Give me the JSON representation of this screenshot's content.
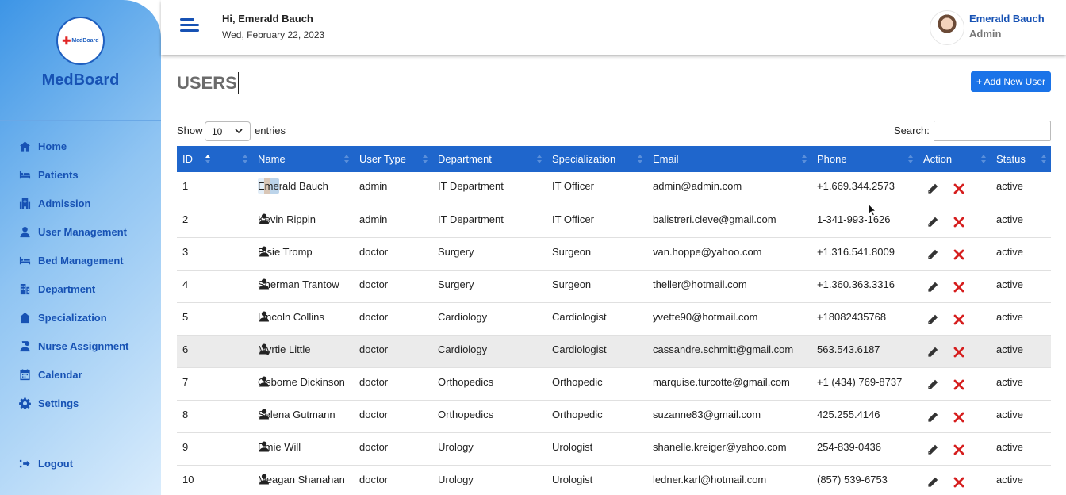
{
  "app": {
    "brand": "MedBoard",
    "logo_mini_text": "MedBoard"
  },
  "sidebar": {
    "items": [
      {
        "label": "Home",
        "icon": "home-icon"
      },
      {
        "label": "Patients",
        "icon": "bed-icon"
      },
      {
        "label": "Admission",
        "icon": "hospital-icon"
      },
      {
        "label": "User Management",
        "icon": "user-icon"
      },
      {
        "label": "Bed Management",
        "icon": "bed-icon"
      },
      {
        "label": "Department",
        "icon": "building-icon"
      },
      {
        "label": "Specialization",
        "icon": "house-medical-icon"
      },
      {
        "label": "Nurse Assignment",
        "icon": "nurse-icon"
      },
      {
        "label": "Calendar",
        "icon": "calendar-icon"
      },
      {
        "label": "Settings",
        "icon": "gear-icon"
      }
    ],
    "logout": {
      "label": "Logout",
      "icon": "logout-icon"
    }
  },
  "header": {
    "greeting": "Hi, Emerald Bauch",
    "date": "Wed, February 22, 2023",
    "user_name": "Emerald Bauch",
    "user_role": "Admin"
  },
  "page": {
    "title": "USERS",
    "add_button": "+ Add New User",
    "show_label": "Show",
    "entries_value": "10",
    "entries_label": "entries",
    "search_label": "Search:",
    "search_value": ""
  },
  "table": {
    "columns": [
      "ID",
      "",
      "Name",
      "User Type",
      "Department",
      "Specialization",
      "Email",
      "Phone",
      "Action",
      "Status"
    ],
    "rows": [
      {
        "id": "1",
        "name": "Emerald Bauch",
        "user_type": "admin",
        "department": "IT Department",
        "specialization": "IT Officer",
        "email": "admin@admin.com",
        "phone": "+1.669.344.2573",
        "status": "active"
      },
      {
        "id": "2",
        "name": "Kevin Rippin",
        "user_type": "admin",
        "department": "IT Department",
        "specialization": "IT Officer",
        "email": "balistreri.cleve@gmail.com",
        "phone": "1-341-993-1626",
        "status": "active"
      },
      {
        "id": "3",
        "name": "Elsie Tromp",
        "user_type": "doctor",
        "department": "Surgery",
        "specialization": "Surgeon",
        "email": "van.hoppe@yahoo.com",
        "phone": "+1.316.541.8009",
        "status": "active"
      },
      {
        "id": "4",
        "name": "Sherman Trantow",
        "user_type": "doctor",
        "department": "Surgery",
        "specialization": "Surgeon",
        "email": "theller@hotmail.com",
        "phone": "+1.360.363.3316",
        "status": "active"
      },
      {
        "id": "5",
        "name": "Lincoln Collins",
        "user_type": "doctor",
        "department": "Cardiology",
        "specialization": "Cardiologist",
        "email": "yvette90@hotmail.com",
        "phone": "+18082435768",
        "status": "active"
      },
      {
        "id": "6",
        "name": "Myrtie Little",
        "user_type": "doctor",
        "department": "Cardiology",
        "specialization": "Cardiologist",
        "email": "cassandre.schmitt@gmail.com",
        "phone": "563.543.6187",
        "status": "active"
      },
      {
        "id": "7",
        "name": "Osborne Dickinson",
        "user_type": "doctor",
        "department": "Orthopedics",
        "specialization": "Orthopedic",
        "email": "marquise.turcotte@gmail.com",
        "phone": "+1 (434) 769-8737",
        "status": "active"
      },
      {
        "id": "8",
        "name": "Selena Gutmann",
        "user_type": "doctor",
        "department": "Orthopedics",
        "specialization": "Orthopedic",
        "email": "suzanne83@gmail.com",
        "phone": "425.255.4146",
        "status": "active"
      },
      {
        "id": "9",
        "name": "Emie Will",
        "user_type": "doctor",
        "department": "Urology",
        "specialization": "Urologist",
        "email": "shanelle.kreiger@yahoo.com",
        "phone": "254-839-0436",
        "status": "active"
      },
      {
        "id": "10",
        "name": "Meagan Shanahan",
        "user_type": "doctor",
        "department": "Urology",
        "specialization": "Urologist",
        "email": "ledner.karl@hotmail.com",
        "phone": "(857) 539-6753",
        "status": "active"
      }
    ]
  },
  "colors": {
    "primary": "#1f66cc",
    "button": "#1a73e8",
    "nav_text": "#1752b4",
    "delete": "#d61f1f",
    "row_highlight": "#ebebeb"
  }
}
